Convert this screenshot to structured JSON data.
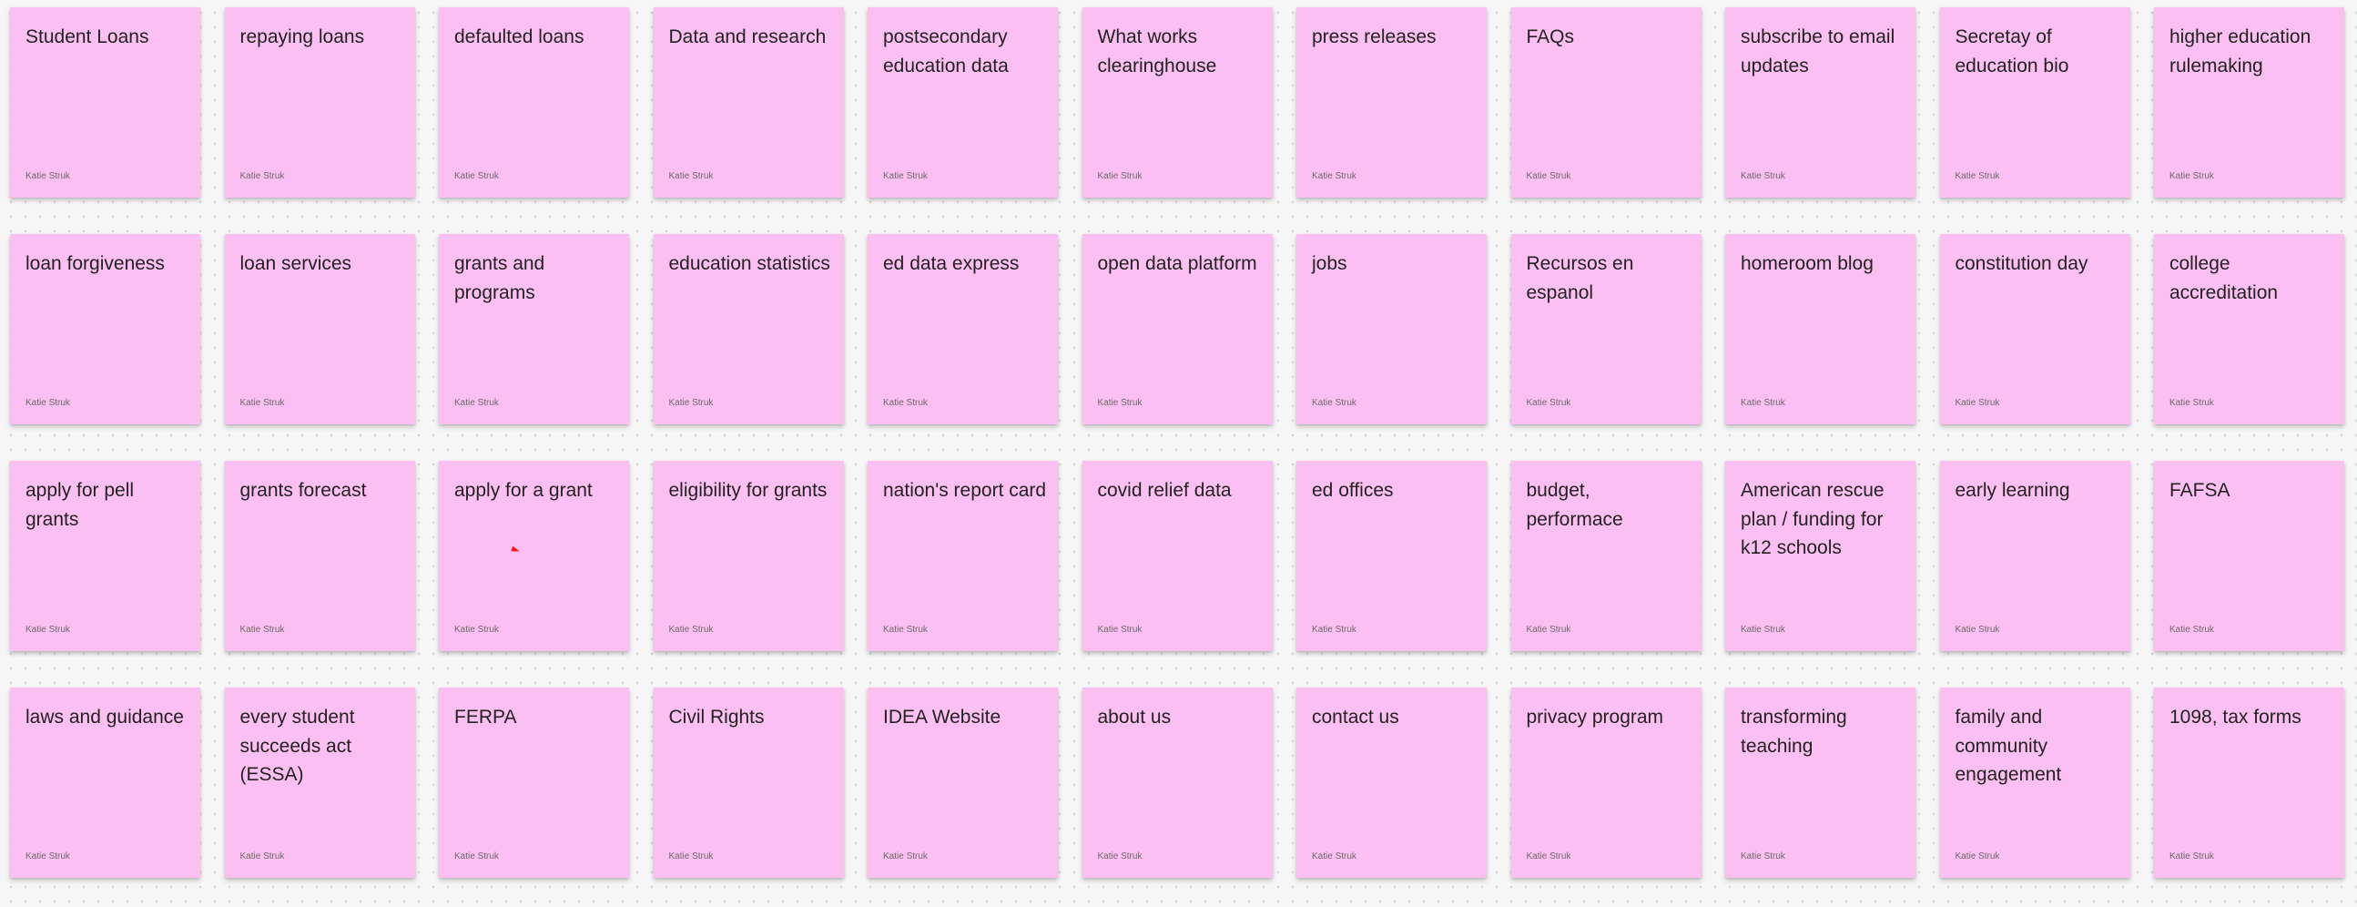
{
  "board": {
    "author": "Katie Struk",
    "note_color": "#fcbff2",
    "cursor_color": "#ff1010",
    "notes": [
      "Student Loans",
      "repaying loans",
      "defaulted loans",
      "Data and research",
      "postsecondary education data",
      "What works clearinghouse",
      "press releases",
      "FAQs",
      "subscribe to email updates",
      "Secretay of education bio",
      "higher education rulemaking",
      "loan forgiveness",
      "loan services",
      "grants and programs",
      "education statistics",
      "ed data express",
      "open data platform",
      "jobs",
      "Recursos en espanol",
      "homeroom blog",
      "constitution day",
      "college accreditation",
      "apply for pell grants",
      "grants forecast",
      "apply for a grant",
      "eligibility for grants",
      "nation's report card",
      "covid relief data",
      "ed offices",
      "budget, performace",
      "American rescue plan / funding for k12 schools",
      "early learning",
      "FAFSA",
      "laws and guidance",
      "every student succeeds act (ESSA)",
      "FERPA",
      "Civil Rights",
      "IDEA Website",
      "about us",
      "contact us",
      "privacy program",
      "transforming teaching",
      "family and community engagement",
      "1098, tax forms"
    ]
  }
}
